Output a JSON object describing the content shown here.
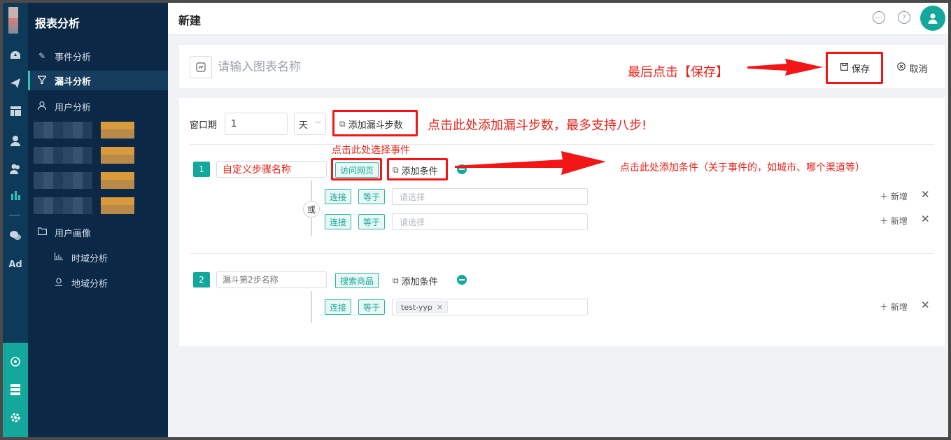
{
  "sidebar": {
    "title": "报表分析",
    "rail_icons": [
      "dashboard-icon",
      "send-icon",
      "layout-icon",
      "user-icon",
      "users-icon",
      "bar-chart-icon",
      "wechat-icon",
      "ad-icon",
      "hub-icon",
      "server-icon",
      "gear-icon"
    ],
    "rail_ad_text": "Ad",
    "items": [
      {
        "label": "事件分析",
        "icon": "edit-icon"
      },
      {
        "label": "漏斗分析",
        "icon": "funnel-icon",
        "active": true
      },
      {
        "label": "用户分析",
        "icon": "user-outline-icon"
      },
      {
        "label": "用户画像",
        "icon": "folder-icon"
      },
      {
        "label": "时域分析",
        "icon": "chart-icon"
      },
      {
        "label": "地域分析",
        "icon": "location-icon"
      }
    ]
  },
  "header": {
    "title": "新建"
  },
  "name_card": {
    "placeholder": "请输入图表名称",
    "save_label": "保存",
    "cancel_label": "取消"
  },
  "funnel": {
    "window_label": "窗口期",
    "window_value": "1",
    "window_unit": "天",
    "add_step_label": "添加漏斗步数",
    "or_label": "或",
    "steps": [
      {
        "number": "1",
        "name_value": "自定义步骤名称",
        "event_tag": "访问网页",
        "add_condition_label": "添加条件",
        "conditions": [
          {
            "connector": "连接",
            "operator": "等于",
            "placeholder": "请选择",
            "add_label": "新增"
          },
          {
            "connector": "连接",
            "operator": "等于",
            "placeholder": "请选择",
            "add_label": "新增"
          }
        ]
      },
      {
        "number": "2",
        "name_placeholder": "漏斗第2步名称",
        "event_tag": "搜索商品",
        "add_condition_label": "添加条件",
        "conditions": [
          {
            "connector": "连接",
            "operator": "等于",
            "value_chip": "test-yyp",
            "add_label": "新增"
          }
        ]
      }
    ]
  },
  "annotations": {
    "save_hint": "最后点击【保存】",
    "add_step_hint": "点击此处添加漏斗步数，最多支持八步!",
    "select_event_hint": "点击此处选择事件",
    "add_condition_hint": "点击此处添加条件（关于事件的，如城市、哪个渠道等）"
  },
  "colors": {
    "accent": "#13a89b",
    "sidebar_bg": "#0b2947",
    "annotation_red": "#e8231a"
  }
}
